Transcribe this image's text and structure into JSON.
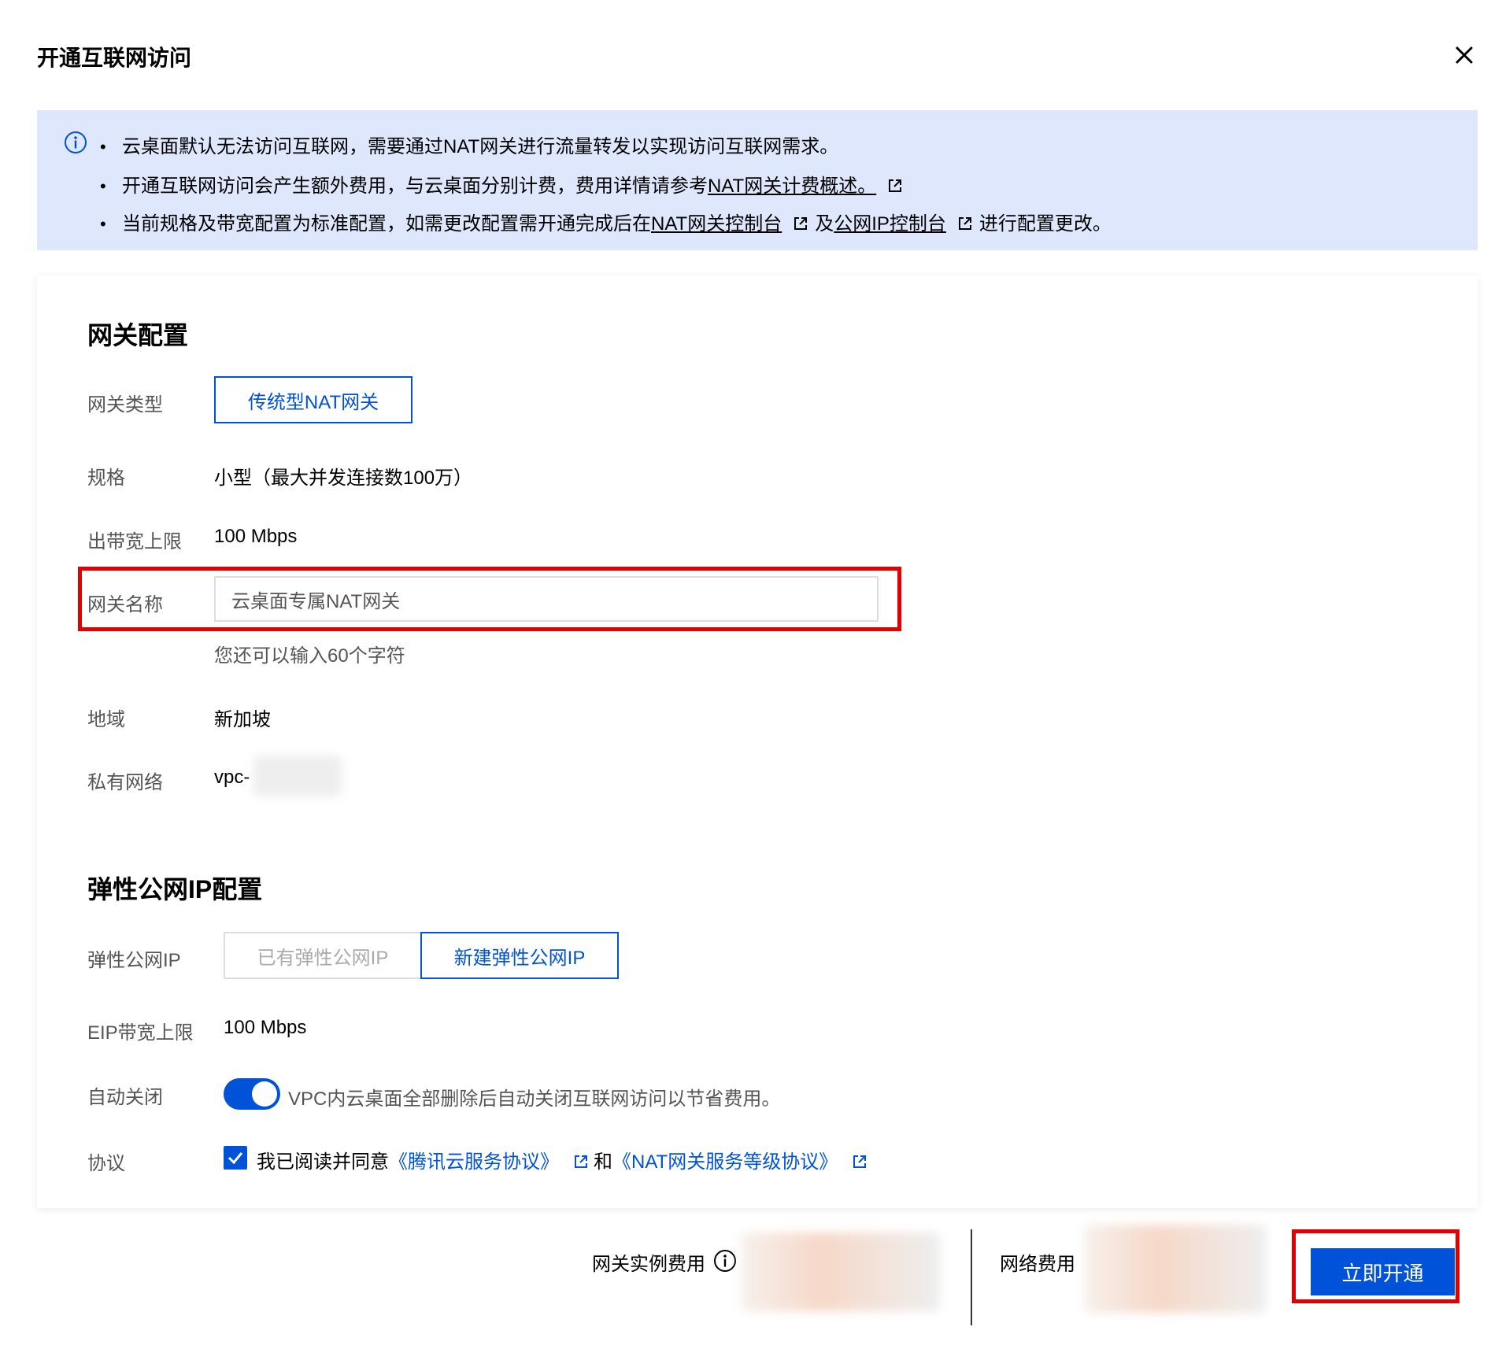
{
  "dialog": {
    "title": "开通互联网访问"
  },
  "notice": {
    "line1": "云桌面默认无法访问互联网，需要通过NAT网关进行流量转发以实现访问互联网需求。",
    "line2_prefix": "开通互联网访问会产生额外费用，与云桌面分别计费，费用详情请参考",
    "line2_link": "NAT网关计费概述。",
    "line3_prefix": "当前规格及带宽配置为标准配置，如需更改配置需开通完成后在",
    "line3_link1": "NAT网关控制台",
    "line3_mid": "及",
    "line3_link2": "公网IP控制台",
    "line3_suffix": "进行配置更改。",
    "bullet": "•"
  },
  "gateway": {
    "section_title": "网关配置",
    "type_label": "网关类型",
    "type_value": "传统型NAT网关",
    "spec_label": "规格",
    "spec_value": "小型（最大并发连接数100万）",
    "bandwidth_label": "出带宽上限",
    "bandwidth_value": "100 Mbps",
    "name_label": "网关名称",
    "name_value": "云桌面专属NAT网关",
    "name_hint": "您还可以输入60个字符",
    "region_label": "地域",
    "region_value": "新加坡",
    "vpc_label": "私有网络",
    "vpc_value": "vpc-"
  },
  "eip": {
    "section_title": "弹性公网IP配置",
    "eip_label": "弹性公网IP",
    "option_existing": "已有弹性公网IP",
    "option_new": "新建弹性公网IP",
    "bandwidth_label": "EIP带宽上限",
    "bandwidth_value": "100 Mbps",
    "auto_close_label": "自动关闭",
    "auto_close_text": "VPC内云桌面全部删除后自动关闭互联网访问以节省费用。",
    "agreement_label": "协议",
    "agreement_prefix": "我已阅读并同意",
    "agreement_link1": "《腾讯云服务协议》",
    "agreement_mid": "和",
    "agreement_link2": "《NAT网关服务等级协议》"
  },
  "footer": {
    "instance_fee_label": "网关实例费用",
    "network_fee_label": "网络费用",
    "submit_label": "立即开通"
  },
  "colors": {
    "primary": "#0052d9",
    "notice_bg": "#dfe7fd",
    "highlight": "#e00000"
  }
}
